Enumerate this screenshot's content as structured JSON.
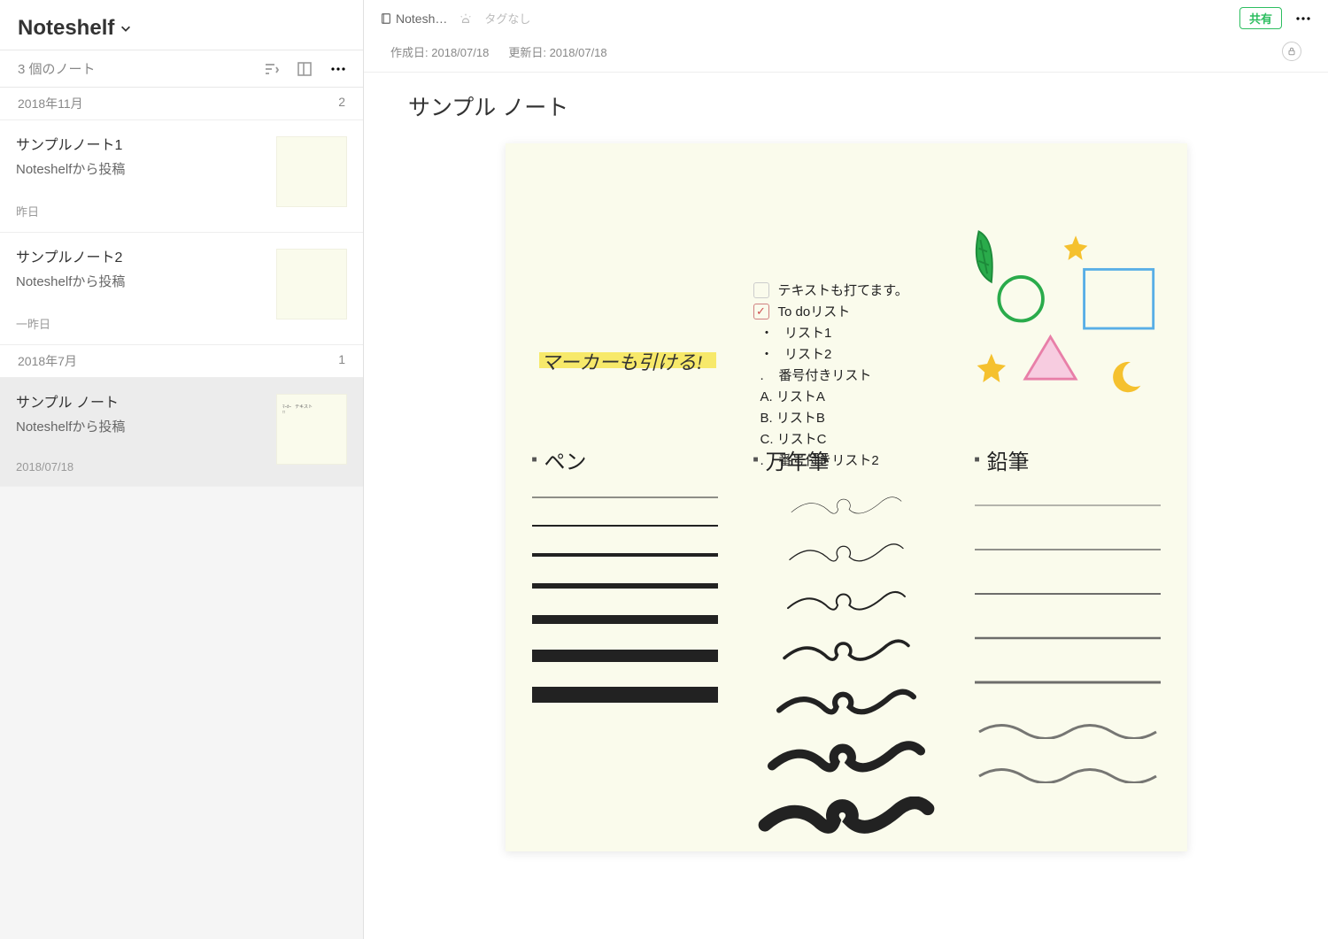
{
  "sidebar": {
    "notebook": "Noteshelf",
    "count_label": "3 個のノート",
    "groups": [
      {
        "label": "2018年11月",
        "count": "2",
        "notes": [
          {
            "title": "サンプルノート1",
            "snippet": "Noteshelfから投稿",
            "date": "昨日",
            "thumb": "plain",
            "selected": false
          },
          {
            "title": "サンプルノート2",
            "snippet": "Noteshelfから投稿",
            "date": "一昨日",
            "thumb": "plain",
            "selected": false
          }
        ]
      },
      {
        "label": "2018年7月",
        "count": "1",
        "notes": [
          {
            "title": "サンプル ノート",
            "snippet": "Noteshelfから投稿",
            "date": "2018/07/18",
            "thumb": "sample",
            "selected": true
          }
        ]
      }
    ]
  },
  "header": {
    "crumb": "Notesh…",
    "tag": "タグなし",
    "share": "共有",
    "created_label": "作成日:",
    "created": "2018/07/18",
    "updated_label": "更新日:",
    "updated": "2018/07/18"
  },
  "doc": {
    "title": "サンプル ノート",
    "highlight": "マーカーも引ける!",
    "text_lines": {
      "line1": "テキストも打てます。",
      "todo": "To doリスト",
      "l1": "リスト1",
      "l2": "リスト2",
      "num": "番号付きリスト",
      "a": "A.    リストA",
      "b": "B.    リストB",
      "c": "C.    リストC",
      "num2": "番号付きリスト2"
    },
    "pen_labels": {
      "pen": "ペン",
      "fountain": "万年筆",
      "pencil": "鉛筆"
    }
  }
}
